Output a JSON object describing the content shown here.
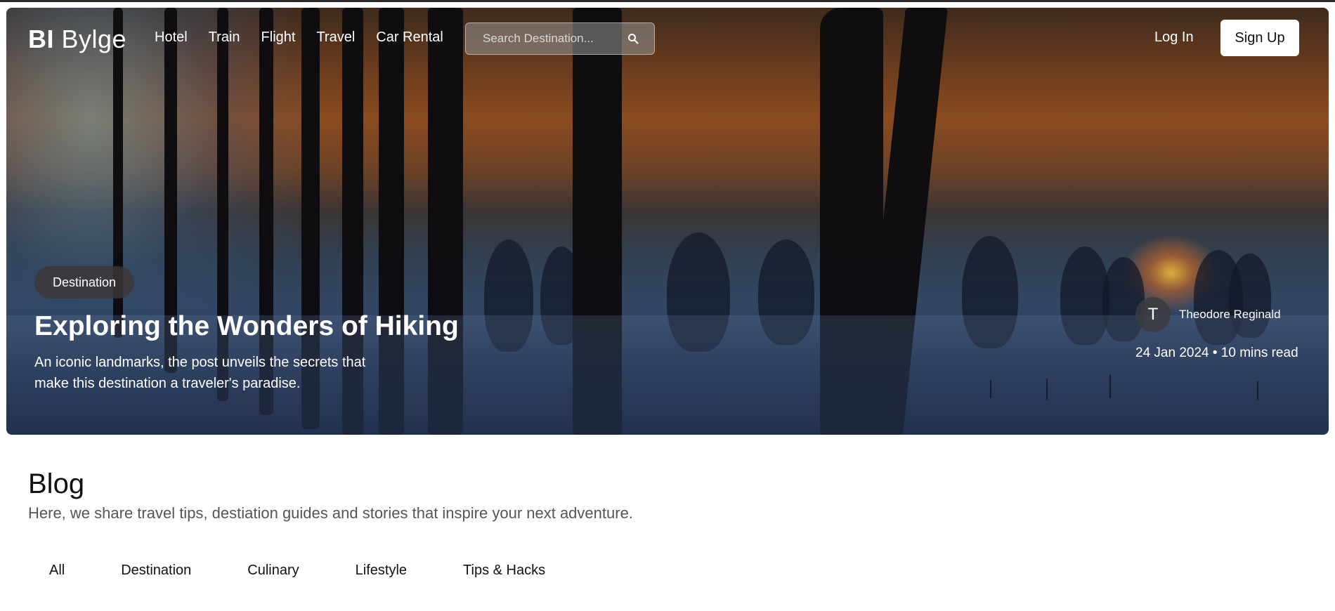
{
  "header": {
    "logo_mark": "BI",
    "logo_name": "Bylge",
    "nav": [
      "Hotel",
      "Train",
      "Flight",
      "Travel",
      "Car Rental"
    ],
    "search_placeholder": "Search Destination...",
    "login": "Log In",
    "signup": "Sign Up"
  },
  "hero": {
    "badge": "Destination",
    "title": "Exploring the Wonders of Hiking",
    "description": "An iconic landmarks, the post unveils the secrets that make this destination a traveler's paradise.",
    "author_initial": "T",
    "author_name": "Theodore Reginald",
    "meta": "24 Jan 2024 • 10 mins read"
  },
  "blog": {
    "title": "Blog",
    "subtitle": "Here, we share travel tips, destiation guides and stories that inspire your next adventure.",
    "tabs": [
      "All",
      "Destination",
      "Culinary",
      "Lifestyle",
      "Tips & Hacks"
    ]
  },
  "colors": {
    "sky_orange": "#8a4b1f",
    "field_blue": "#3c5474",
    "signup_bg": "#ffffff"
  },
  "icons": {
    "search": "search-icon"
  }
}
